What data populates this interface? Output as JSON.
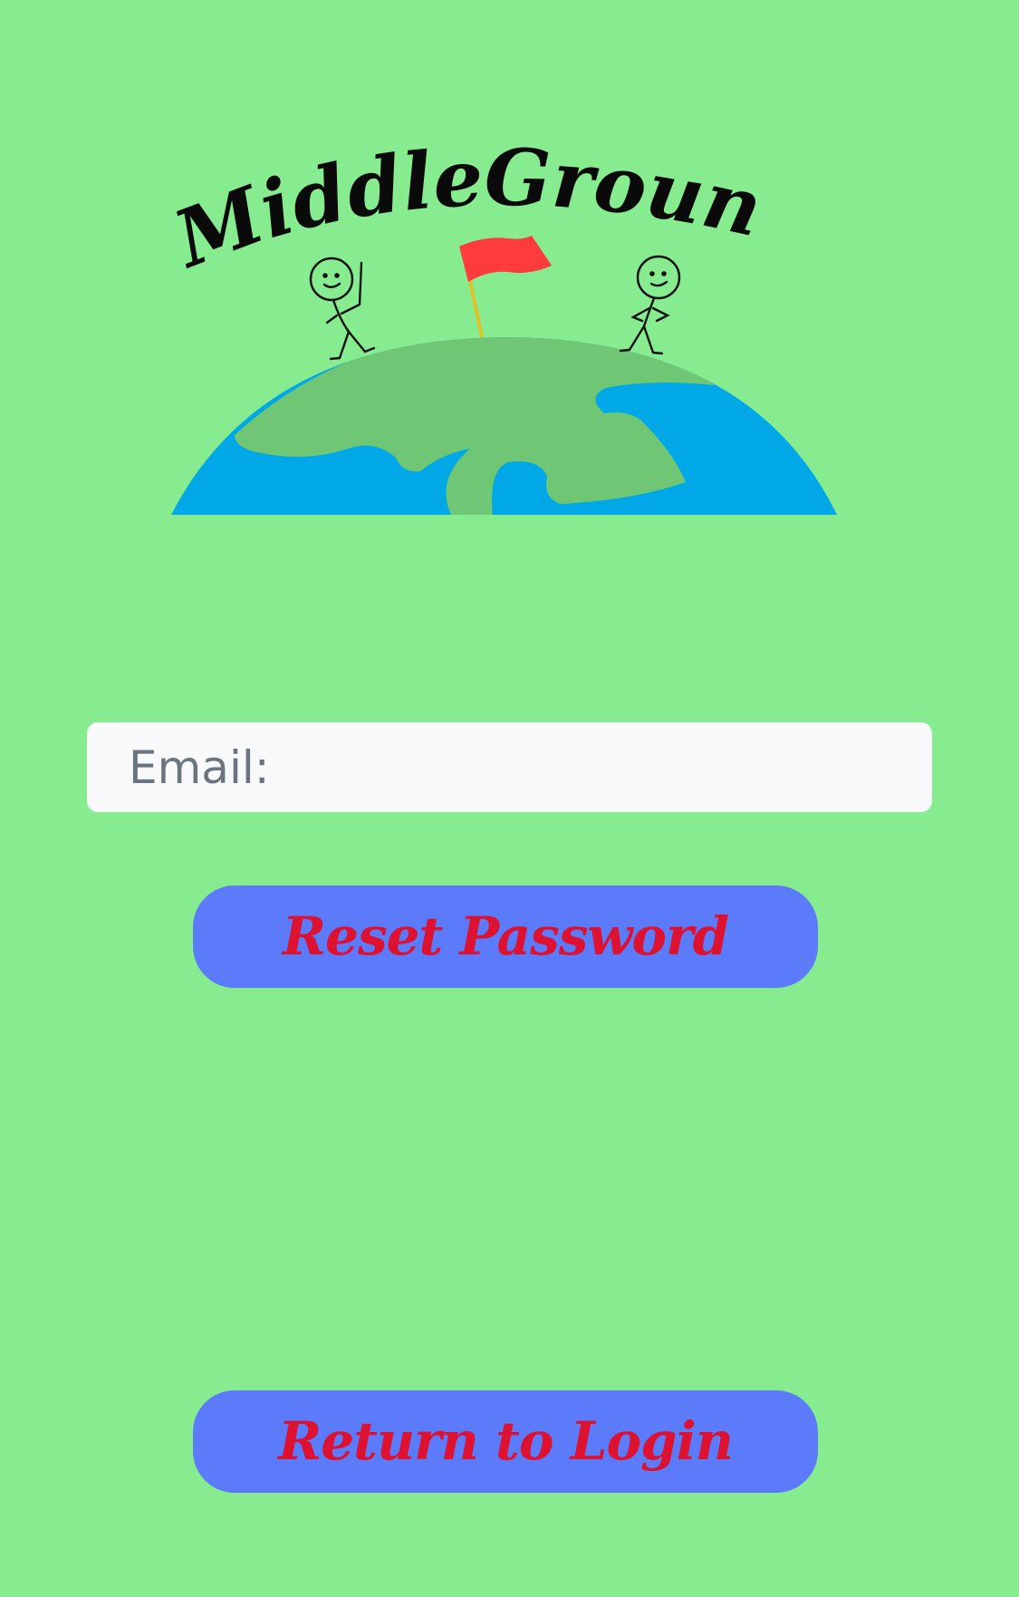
{
  "logo": {
    "text": "MiddleGround"
  },
  "form": {
    "email_value": "",
    "email_placeholder": "Email:"
  },
  "buttons": {
    "reset_label": "Reset Password",
    "return_label": "Return to Login"
  },
  "colors": {
    "background": "#87eb8f",
    "button_fill": "#5b7bfa",
    "button_text": "#dc1230",
    "input_fill": "#f8f9fa",
    "ocean": "#00a8e8",
    "land": "#6fc674",
    "flag": "#ff3b3b"
  }
}
